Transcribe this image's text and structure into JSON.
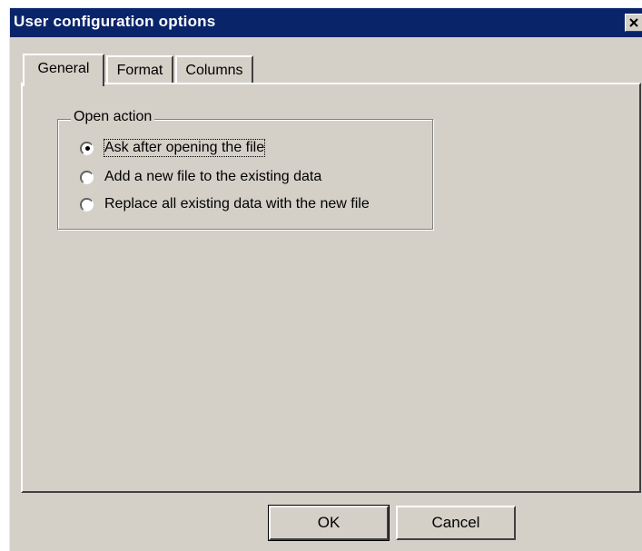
{
  "window": {
    "title": "User configuration options",
    "close_icon": "close-icon",
    "title_bar_color": "#0a246a",
    "face_color": "#d4d0c8"
  },
  "tabs": [
    {
      "label": "General",
      "active": true
    },
    {
      "label": "Format",
      "active": false
    },
    {
      "label": "Columns",
      "active": false
    }
  ],
  "open_action": {
    "legend": "Open action",
    "options": [
      {
        "label": "Ask after opening the file",
        "selected": true
      },
      {
        "label": "Add a new file to the existing data",
        "selected": false
      },
      {
        "label": "Replace all existing data with the new file",
        "selected": false
      }
    ]
  },
  "buttons": {
    "ok_label": "OK",
    "cancel_label": "Cancel"
  }
}
